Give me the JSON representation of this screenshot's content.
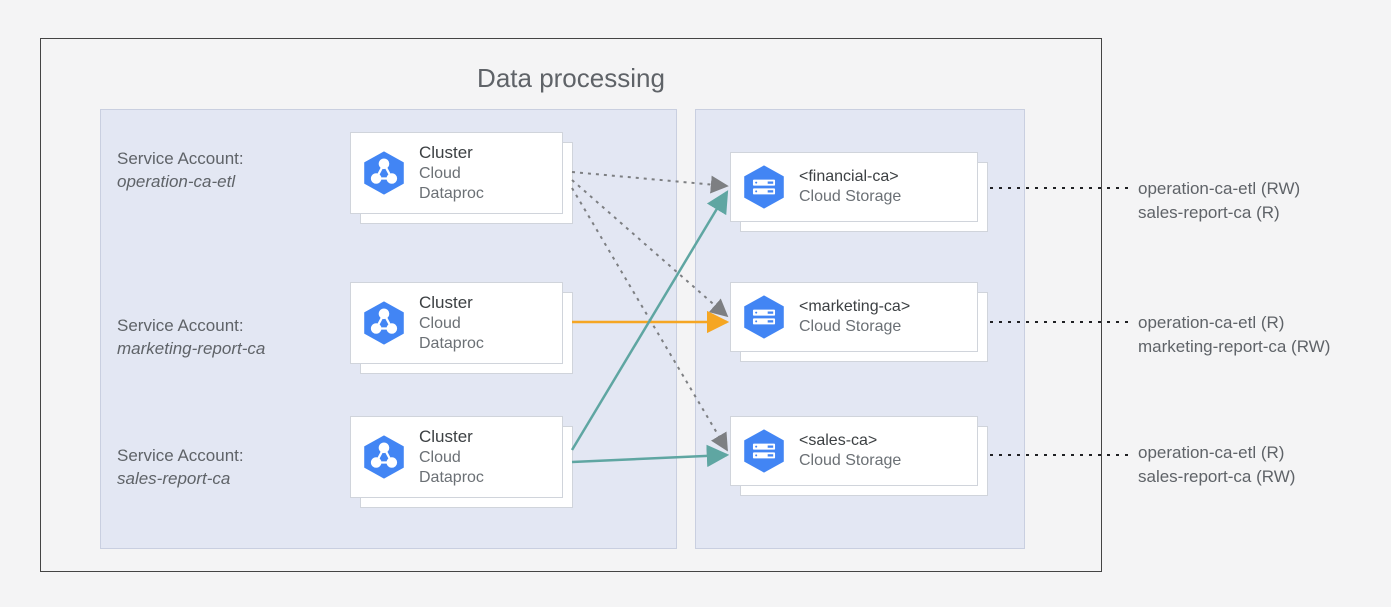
{
  "title": "Data processing",
  "service_accounts": [
    {
      "label": "Service Account:",
      "name": "operation-ca-etl"
    },
    {
      "label": "Service Account:",
      "name": "marketing-report-ca"
    },
    {
      "label": "Service Account:",
      "name": "sales-report-ca"
    }
  ],
  "clusters": [
    {
      "title": "Cluster",
      "sub1": "Cloud",
      "sub2": "Dataproc"
    },
    {
      "title": "Cluster",
      "sub1": "Cloud",
      "sub2": "Dataproc"
    },
    {
      "title": "Cluster",
      "sub1": "Cloud",
      "sub2": "Dataproc"
    }
  ],
  "buckets": [
    {
      "title": "<financial-ca>",
      "sub": "Cloud Storage"
    },
    {
      "title": "<marketing-ca>",
      "sub": "Cloud Storage"
    },
    {
      "title": "<sales-ca>",
      "sub": "Cloud Storage"
    }
  ],
  "permissions": [
    {
      "line1": "operation-ca-etl (RW)",
      "line2": "sales-report-ca (R)"
    },
    {
      "line1": "operation-ca-etl (R)",
      "line2": "marketing-report-ca (RW)"
    },
    {
      "line1": "operation-ca-etl (R)",
      "line2": "sales-report-ca (RW)"
    }
  ],
  "colors": {
    "gcp_blue": "#4285f4",
    "arrow_teal": "#5fa6a2",
    "arrow_orange": "#f5a623",
    "arrow_grey": "#7d7f82"
  }
}
